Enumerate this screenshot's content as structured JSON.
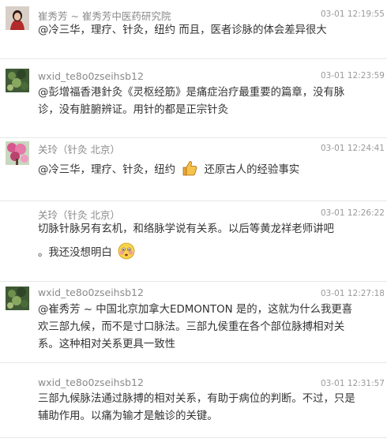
{
  "comments": [
    {
      "author": "崔秀芳 ~ 崔秀芳中医药研究院",
      "time": "03-01 12:19:55",
      "text": "@冷三华，理疗、针灸，纽约 而且，医者诊脉的体会差异很大"
    },
    {
      "author": "wxid_te8o0zseihsb12",
      "time": "03-01 12:23:59",
      "text": "@彭增福香港針灸《灵枢经筋》是痛症治疗最重要的篇章，没有脉诊，没有脏腑辨证。用针的都是正宗针灸"
    },
    {
      "author": "关玲（针灸 北京）",
      "time": "03-01 12:24:41",
      "text_before": "@冷三华，理疗、针灸，纽约",
      "emoji": "thumbs-up-emoji",
      "text_after": "还原古人的经验事实"
    },
    {
      "author": "关玲（针灸 北京）",
      "time": "03-01 12:26:22",
      "text_line1": "切脉针脉另有玄机，和络脉学说有关系。以后等黄龙祥老师讲吧",
      "text_line2": "。我还没想明白",
      "emoji": "blush-face-emoji"
    },
    {
      "author": "wxid_te8o0zseihsb12",
      "time": "03-01 12:27:18",
      "text": "@崔秀芳 ~ 中国北京加拿大EDMONTON 是的，这就为什么我更喜欢三部九候，而不是寸口脉法。三部九侯重在各个部位脉搏相对关系。这种相对关系更具一致性"
    },
    {
      "author": "wxid_te8o0zseihsb12",
      "time": "03-01 12:31:57",
      "text": "三部九候脉法通过脉搏的相对关系，有助于病位的判断。不过，只是辅助作用。以痛为输才是触诊的关键。"
    }
  ]
}
